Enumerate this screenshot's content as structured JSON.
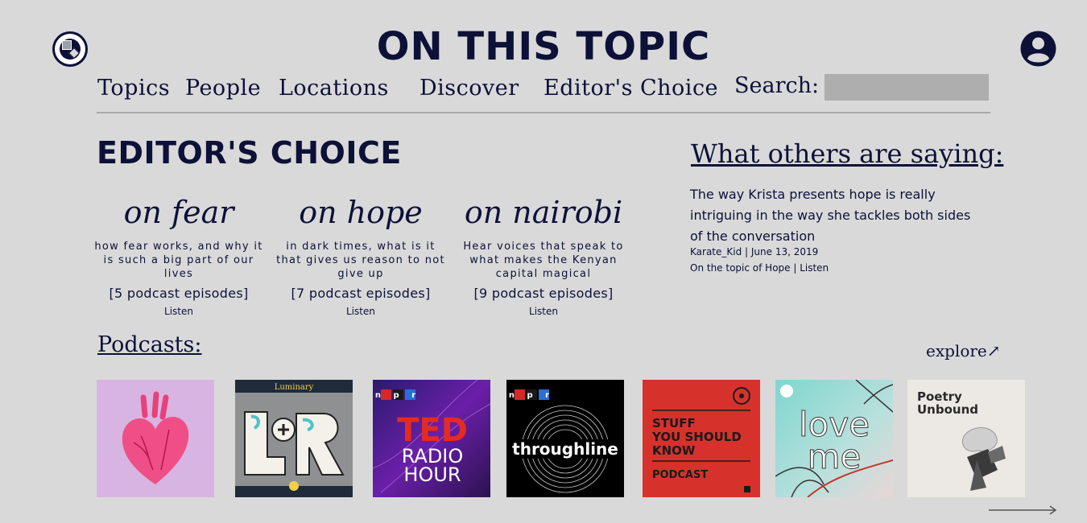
{
  "header": {
    "title": "ON THIS TOPIC",
    "logo_icon": "vinyl-record-logo-icon",
    "account_icon": "user-account-icon"
  },
  "nav": {
    "items": [
      "Topics",
      "People",
      "Locations",
      "Discover",
      "Editor's Choice"
    ],
    "search_label": "Search:",
    "search_value": ""
  },
  "editors_choice": {
    "title": "EDITOR'S CHOICE",
    "cards": [
      {
        "title": "on fear",
        "description": "how fear works, and why it is such a big part of our lives",
        "count": "[5 podcast episodes]",
        "action": "Listen"
      },
      {
        "title": "on hope",
        "description": "in dark times, what is it that gives us reason to not give up",
        "count": "[7 podcast episodes]",
        "action": "Listen"
      },
      {
        "title": "on nairobi",
        "description": "Hear voices that speak to what makes the Kenyan capital magical",
        "count": "[9 podcast episodes]",
        "action": "Listen"
      }
    ]
  },
  "others": {
    "heading": "What others are saying:",
    "review": "The way Krista presents hope is really intriguing in the way she tackles both sides of the conversation",
    "meta": "Karate_Kid | June 13, 2019",
    "topic": "On the topic of Hope | Listen"
  },
  "podcasts": {
    "heading": "Podcasts:",
    "explore": "explore↗",
    "tiles": {
      "luminary_label": "Luminary",
      "npr_label": "n p r",
      "ted_label": "TED",
      "radio_label": "RADIO",
      "hour_label": "HOUR",
      "throughline_label": "throughline",
      "stuff_l1": "STUFF",
      "stuff_l2": "YOU SHOULD",
      "stuff_l3": "KNOW",
      "stuff_l4": "PODCAST",
      "love_label": "love",
      "me_label": "me",
      "poetry_l1": "Poetry",
      "poetry_l2": "Unbound"
    },
    "next_icon": "long-right-arrow-icon"
  },
  "colors": {
    "background": "#d9d9d9",
    "navy": "#0d1138",
    "search_bg": "#aeaeae"
  }
}
